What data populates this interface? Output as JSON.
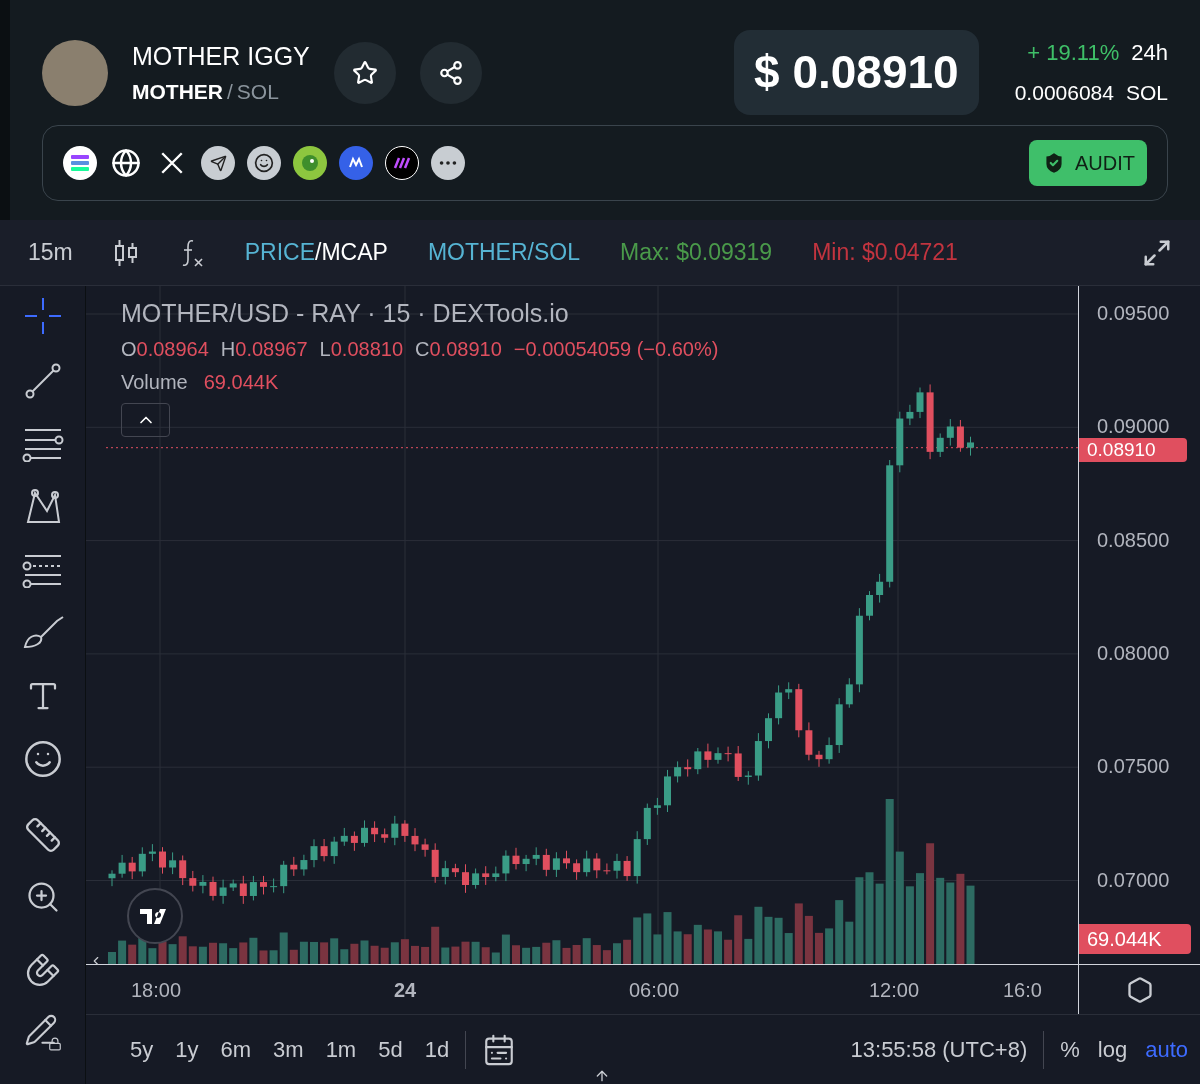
{
  "token": {
    "name": "MOTHER IGGY",
    "symbol": "MOTHER",
    "separator": "/",
    "quote": "SOL"
  },
  "price": {
    "usd": "$ 0.08910",
    "change": "+ 19.11%",
    "period": "24h",
    "native": "0.0006084",
    "native_unit": "SOL"
  },
  "links": {
    "audit_label": "AUDIT"
  },
  "toolbar": {
    "interval": "15m",
    "mode_options": [
      {
        "label": "PRICE",
        "selected": true
      },
      {
        "label": "MCAP",
        "selected": false
      }
    ],
    "mode_separator": "/",
    "pair": "MOTHER/SOL",
    "max": "Max: $0.09319",
    "min": "Min: $0.04721"
  },
  "legend": {
    "title": "MOTHER/USD - RAY · 15 · DEXTools.io",
    "ohlc": [
      {
        "label": "O",
        "value": "0.08964"
      },
      {
        "label": "H",
        "value": "0.08967"
      },
      {
        "label": "L",
        "value": "0.08810"
      },
      {
        "label": "C",
        "value": "0.08910"
      }
    ],
    "change": "−0.00054059 (−0.60%)",
    "volume_label": "Volume",
    "volume_value": "69.044K"
  },
  "price_axis": [
    "0.09500",
    "0.09000",
    "0.08500",
    "0.08000",
    "0.07500",
    "0.07000"
  ],
  "price_tag": "0.08910",
  "volume_tag": "69.044K",
  "time_axis": [
    {
      "label": "18:00",
      "kind": "time"
    },
    {
      "label": "24",
      "kind": "day"
    },
    {
      "label": "06:00",
      "kind": "time"
    },
    {
      "label": "12:00",
      "kind": "time"
    },
    {
      "label": "16:0",
      "kind": "time"
    }
  ],
  "ranges": [
    {
      "label": "5y"
    },
    {
      "label": "1y"
    },
    {
      "label": "6m"
    },
    {
      "label": "3m"
    },
    {
      "label": "1m"
    },
    {
      "label": "5d"
    },
    {
      "label": "1d"
    }
  ],
  "clock": "13:55:58 (UTC+8)",
  "scale_options": [
    {
      "label": "%",
      "selected": false
    },
    {
      "label": "log",
      "selected": false
    },
    {
      "label": "auto",
      "selected": true
    }
  ]
}
